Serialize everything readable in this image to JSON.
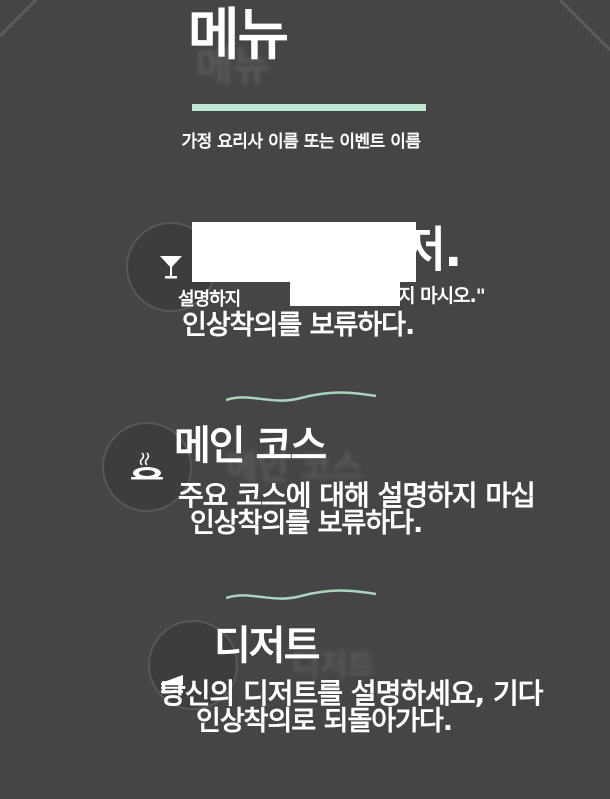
{
  "menu": {
    "title": "메뉴",
    "subtitle": "가정 요리사 이름 또는 이벤트 이름"
  },
  "sections": [
    {
      "title": "저.",
      "line1": "설명하지",
      "line1_tail": "지 마시오.\"",
      "line2": "인상착의를 보류하다.",
      "icon": "cocktail-glass-icon"
    },
    {
      "title": "메인 코스",
      "line1": "주요 코스에 대해 설명하지 마십",
      "line2": "인상착의를 보류하다.",
      "icon": "steaming-dish-icon"
    },
    {
      "title": "디저트",
      "line1": "당신의 디저트를 설명하세요, 기다",
      "line2": "인상착의로 되돌아가다.",
      "icon": "cake-slice-icon"
    }
  ],
  "colors": {
    "background": "#454545",
    "accent": "#bfe8d4",
    "divider": "#a8d4c0"
  }
}
